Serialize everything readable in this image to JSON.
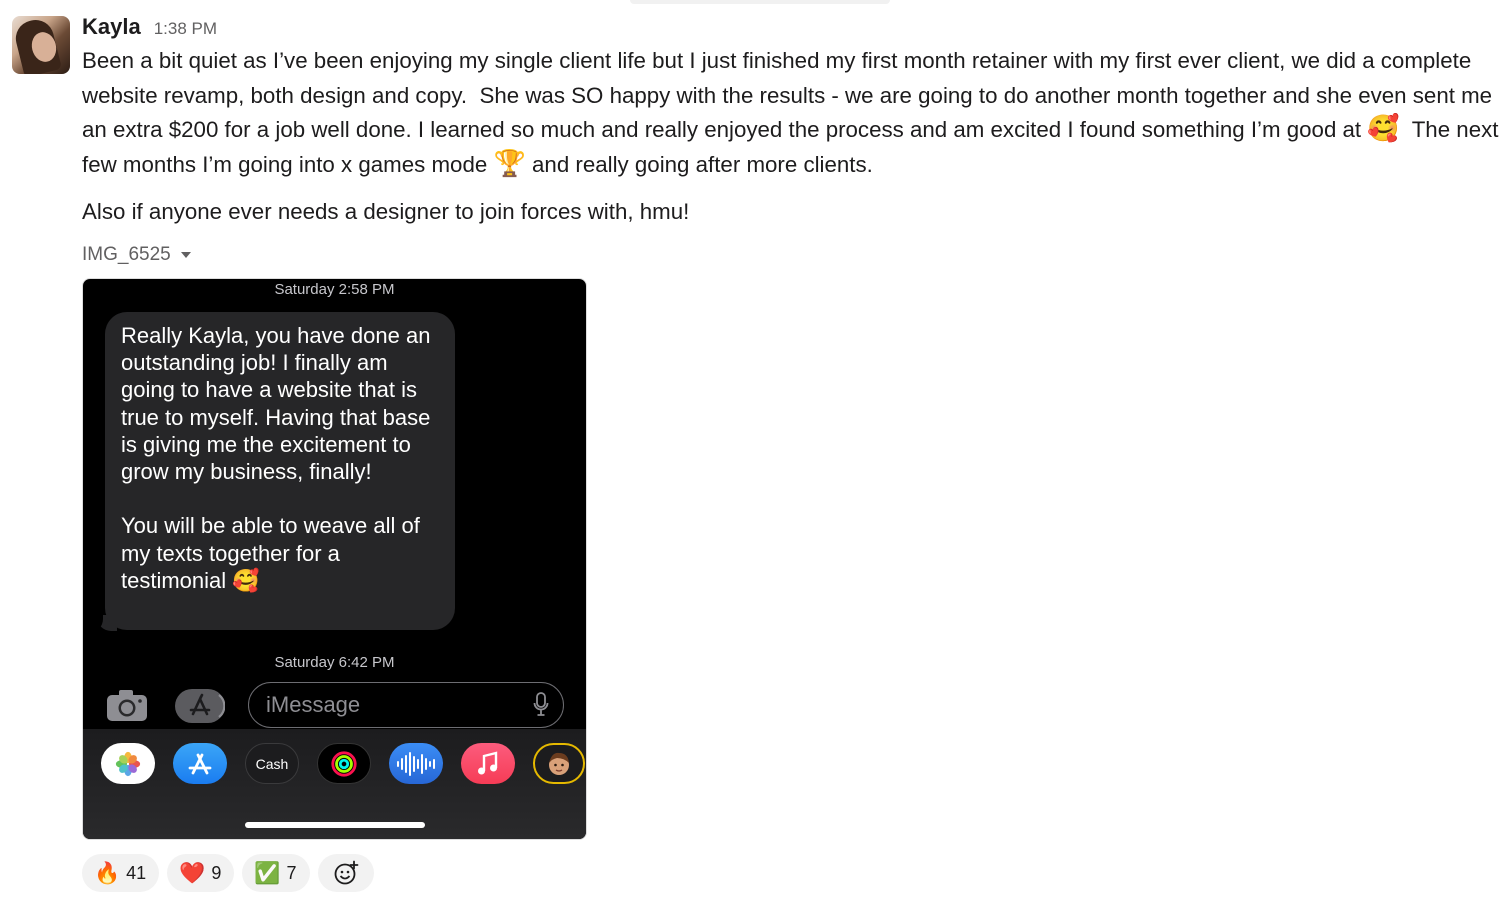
{
  "message": {
    "sender": "Kayla",
    "time": "1:38 PM",
    "text_part1": "Been a bit quiet as I’ve been enjoying my single client life but I just finished my first month retainer with my first ever client, we did a complete website revamp, both design and copy.  She was SO happy with the results - we are going to do another month together and she even sent me an extra $200 for a job well done. I learned so much and really enjoyed the process and am excited I found something I’m good at ",
    "emoji_1": "🥰",
    "text_part2": "  The next few months I’m going into x games mode ",
    "emoji_2": "🏆",
    "text_part3": " and really going after more clients.",
    "paragraph_2": "Also if anyone ever needs a designer to join forces with, hmu!",
    "attachment_name": "IMG_6525"
  },
  "screenshot": {
    "timestamp_top": "Saturday 2:58 PM",
    "bubble_text": "Really Kayla, you have done an outstanding job! I finally am going to have a website that is true to myself. Having that base is giving me the excitement to grow my business, finally!\n\nYou will be able to weave all of my texts together for a testimonial 🥰",
    "timestamp_bottom": "Saturday 6:42 PM",
    "input_placeholder": "iMessage",
    "apps": [
      "photos-icon",
      "app-store-icon",
      "apple-cash-icon",
      "activity-icon",
      "audio-message-icon",
      "music-icon",
      "memoji-icon"
    ],
    "cash_label": "Cash"
  },
  "reactions": [
    {
      "emoji": "🔥",
      "count": "41"
    },
    {
      "emoji": "❤️",
      "count": "9"
    },
    {
      "emoji": "✅",
      "count": "7"
    }
  ],
  "colors": {
    "text": "#1d1c1d",
    "muted": "#616061",
    "bubble": "#262628",
    "reaction_bg": "#f2f2f2"
  }
}
